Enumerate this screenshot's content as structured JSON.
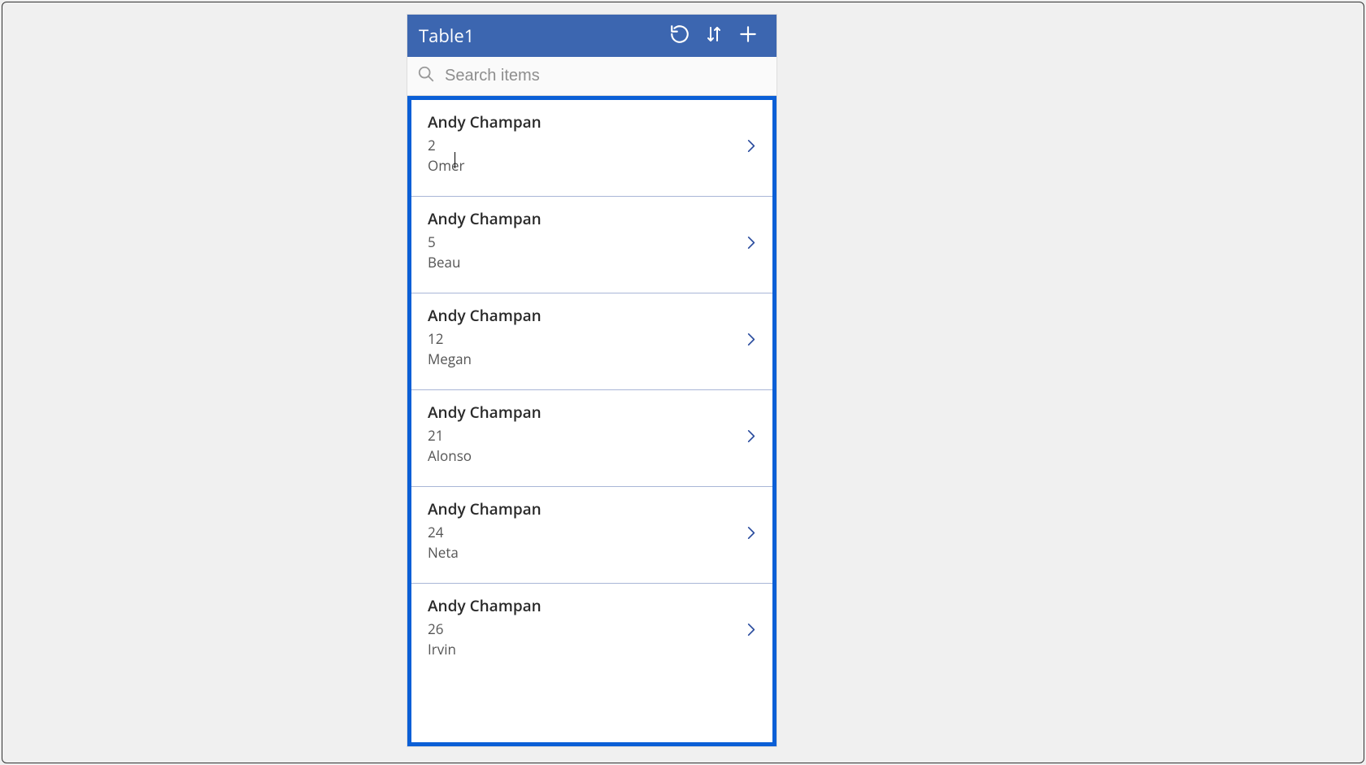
{
  "colors": {
    "appbar": "#3c66b0",
    "selection_border": "#0b5fd6",
    "chevron": "#2a4c9e"
  },
  "header": {
    "title": "Table1",
    "icons": {
      "refresh": "refresh-icon",
      "sort": "sort-icon",
      "add": "plus-icon"
    }
  },
  "search": {
    "placeholder": "Search items",
    "value": ""
  },
  "items": [
    {
      "title": "Andy Champan",
      "line2": "2",
      "line3": "Omer"
    },
    {
      "title": "Andy Champan",
      "line2": "5",
      "line3": "Beau"
    },
    {
      "title": "Andy Champan",
      "line2": "12",
      "line3": "Megan"
    },
    {
      "title": "Andy Champan",
      "line2": "21",
      "line3": "Alonso"
    },
    {
      "title": "Andy Champan",
      "line2": "24",
      "line3": "Neta"
    },
    {
      "title": "Andy Champan",
      "line2": "26",
      "line3": "Irvin"
    }
  ]
}
